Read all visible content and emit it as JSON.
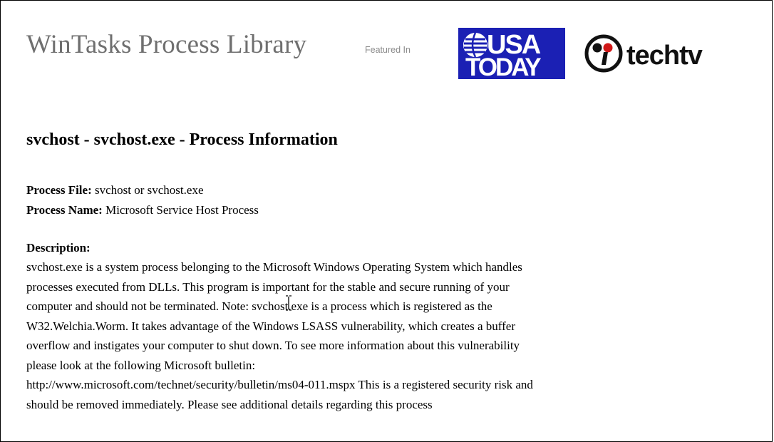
{
  "header": {
    "site_title": "WinTasks Process Library",
    "featured_label": "Featured In",
    "usa_logo_line1": "USA",
    "usa_logo_line2": "TODAY",
    "techtv_label": "techtv"
  },
  "page": {
    "title": "svchost - svchost.exe - Process Information"
  },
  "process": {
    "file_label": "Process File:",
    "file_value": " svchost or svchost.exe",
    "name_label": "Process Name:",
    "name_value": " Microsoft Service Host Process"
  },
  "description": {
    "label": "Description:",
    "lines": [
      "svchost.exe is a system process belonging to the Microsoft Windows Operating System which handles",
      "processes executed from DLLs. This program is important for the stable and secure running of your",
      "computer and should not be terminated. Note: svchost.exe is a process which is registered as the",
      "W32.Welchia.Worm. It takes advantage of the Windows LSASS vulnerability, which creates a buffer",
      "overflow and instigates your computer to shut down. To see more information about this vulnerability",
      "please look at the following Microsoft bulletin:",
      "http://www.microsoft.com/technet/security/bulletin/ms04-011.mspx This is a registered security risk and",
      "should be removed immediately. Please see additional details regarding this process"
    ]
  },
  "colors": {
    "usa_today_blue": "#1b20b4",
    "title_gray": "#6f6f6f",
    "techtv_red": "#d01818",
    "border": "#000000"
  },
  "icons": {
    "cursor": "text-cursor-icon",
    "usa_globe": "usa-today-globe-icon",
    "techtv_mark": "techtv-mark-icon"
  }
}
